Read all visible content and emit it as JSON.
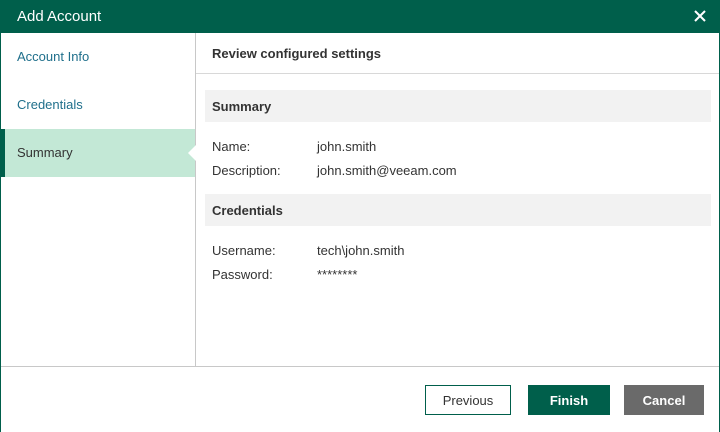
{
  "window": {
    "title": "Add Account"
  },
  "sidebar": {
    "items": [
      {
        "label": "Account Info"
      },
      {
        "label": "Credentials"
      },
      {
        "label": "Summary"
      }
    ]
  },
  "content": {
    "header": "Review configured settings",
    "summary": {
      "title": "Summary",
      "name_label": "Name:",
      "name_value": "john.smith",
      "description_label": "Description:",
      "description_value": "john.smith@veeam.com"
    },
    "credentials": {
      "title": "Credentials",
      "username_label": "Username:",
      "username_value": "tech\\john.smith",
      "password_label": "Password:",
      "password_value": "********"
    }
  },
  "footer": {
    "previous_label": "Previous",
    "finish_label": "Finish",
    "cancel_label": "Cancel"
  },
  "colors": {
    "brand": "#005f4b",
    "active_nav": "#c3e8d6",
    "link": "#1f6f8b",
    "cancel": "#6a6a6a"
  }
}
